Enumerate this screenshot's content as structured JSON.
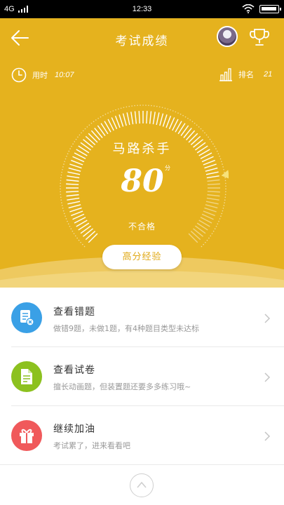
{
  "status_bar": {
    "network": "4G",
    "time": "12:33"
  },
  "header": {
    "title": "考试成绩"
  },
  "stats": {
    "time_label": "用时",
    "time_value": "10:07",
    "rank_label": "排名",
    "rank_value": "21"
  },
  "result": {
    "nickname": "马路杀手",
    "score": "80",
    "score_unit": "分",
    "verdict": "不合格",
    "score_fraction": 0.8,
    "exp_button": "高分经验"
  },
  "menu": [
    {
      "title": "查看错题",
      "desc": "做错9题，未做1题，有4种题目类型未达标",
      "color": "#3aa0e6",
      "icon": "wrong-questions-icon"
    },
    {
      "title": "查看试卷",
      "desc": "擅长动画题，但装置题还要多多练习哦~",
      "color": "#8cc11f",
      "icon": "exam-paper-icon"
    },
    {
      "title": "继续加油",
      "desc": "考试累了，进来看看吧",
      "color": "#f0595b",
      "icon": "gift-icon"
    }
  ],
  "colors": {
    "accent": "#e5b21e",
    "text": "#333333",
    "muted": "#999999"
  }
}
